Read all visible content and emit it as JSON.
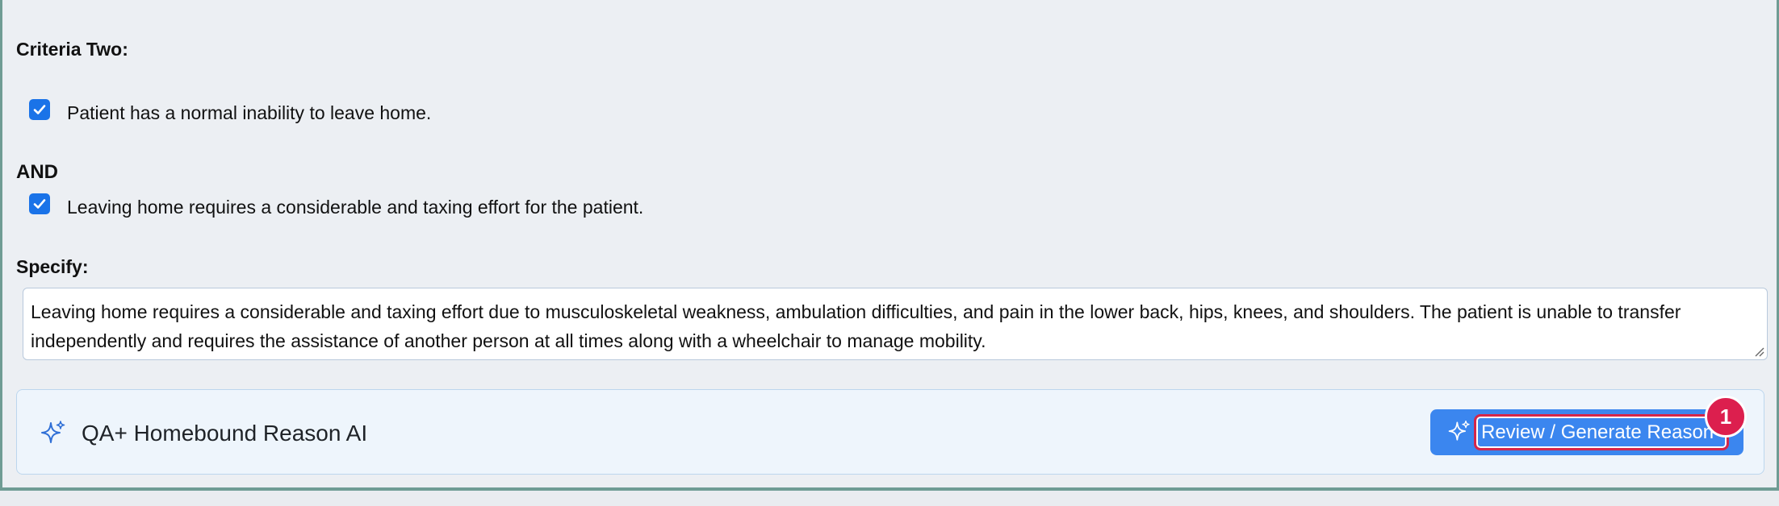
{
  "criteria_two": {
    "heading": "Criteria Two:",
    "item1": {
      "label": "Patient has a normal inability to leave home.",
      "checked": true
    },
    "connector": "AND",
    "item2": {
      "label": "Leaving home requires a considerable and taxing effort for the patient.",
      "checked": true
    }
  },
  "specify": {
    "label": "Specify:",
    "value": "Leaving home requires a considerable and taxing effort due to musculoskeletal weakness, ambulation difficulties, and pain in the lower back, hips, knees, and shoulders. The patient is unable to transfer independently and requires the assistance of another person at all times along with a wheelchair to manage mobility."
  },
  "ai_panel": {
    "title": "QA+ Homebound Reason AI",
    "icon": "sparkle-icon",
    "button_label": "Review / Generate Reason",
    "badge": "1"
  },
  "colors": {
    "accent": "#3b86ef",
    "checkbox": "#1a73e8",
    "badge": "#dc1f4e",
    "focus_ring": "#d4264a"
  }
}
